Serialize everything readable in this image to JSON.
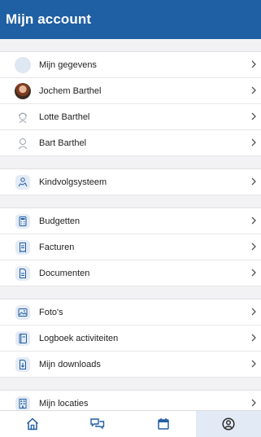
{
  "header": {
    "title": "Mijn account"
  },
  "groups": [
    [
      {
        "label": "Mijn gegevens",
        "icon": "avatar-placeholder-icon"
      },
      {
        "label": "Jochem Barthel",
        "icon": "profile-photo"
      },
      {
        "label": "Lotte Barthel",
        "icon": "child-outline-icon"
      },
      {
        "label": "Bart Barthel",
        "icon": "person-outline-icon"
      }
    ],
    [
      {
        "label": "Kindvolgsysteem",
        "icon": "child-tracking-icon"
      }
    ],
    [
      {
        "label": "Budgetten",
        "icon": "calculator-icon"
      },
      {
        "label": "Facturen",
        "icon": "invoice-icon"
      },
      {
        "label": "Documenten",
        "icon": "document-icon"
      }
    ],
    [
      {
        "label": "Foto's",
        "icon": "photo-icon"
      },
      {
        "label": "Logboek activiteiten",
        "icon": "logbook-icon"
      },
      {
        "label": "Mijn downloads",
        "icon": "download-icon"
      }
    ],
    [
      {
        "label": "Mijn locaties",
        "icon": "building-icon"
      }
    ]
  ],
  "tabbar": {
    "tabs": [
      {
        "name": "home",
        "icon": "home-icon",
        "active": false
      },
      {
        "name": "messages",
        "icon": "chat-icon",
        "active": false
      },
      {
        "name": "calendar",
        "icon": "calendar-icon",
        "active": false
      },
      {
        "name": "account",
        "icon": "account-icon",
        "active": true
      }
    ]
  },
  "colors": {
    "header": "#1f5fa3",
    "icon": "#1f5fa3",
    "active_tab_bg": "#e2eaf5"
  }
}
